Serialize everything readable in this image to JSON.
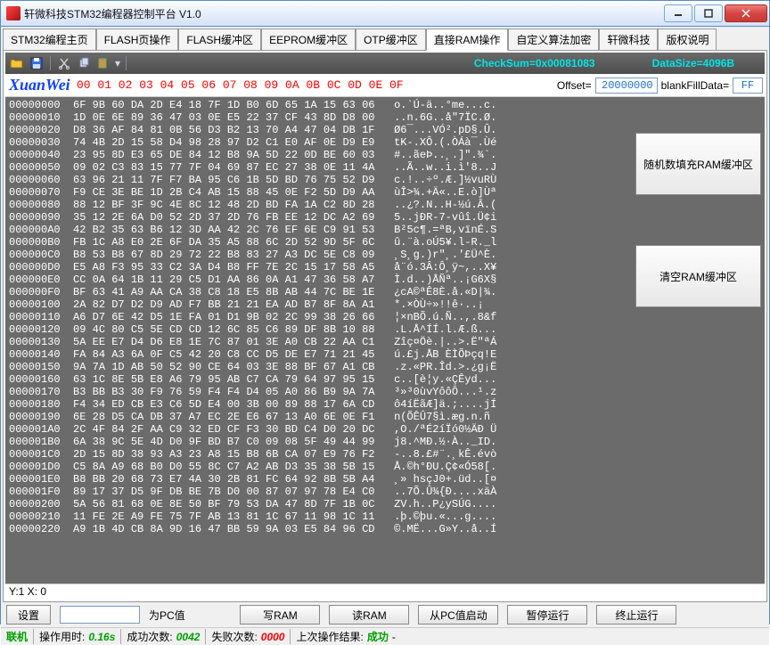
{
  "window": {
    "title": "轩微科技STM32编程器控制平台  V1.0"
  },
  "tabs": [
    "STM32编程主页",
    "FLASH页操作",
    "FLASH缓冲区",
    "EEPROM缓冲区",
    "OTP缓冲区",
    "直接RAM操作",
    "自定义算法加密",
    "轩微科技",
    "版权说明"
  ],
  "activeTab": 5,
  "toolbar": {
    "checksum": "CheckSum=0x00081083",
    "datasize": "DataSize=4096B"
  },
  "header": {
    "brand": "XuanWei",
    "cols": "00 01 02 03 04 05 06 07 08 09 0A 0B 0C 0D 0E 0F",
    "offsetLabel": "Offset=",
    "offset": "20000000",
    "blankLabel": "blankFillData=",
    "blank": "FF"
  },
  "statusYX": "Y:1   X: 0",
  "buttons": {
    "set": "设置",
    "pcLabel": "为PC值",
    "write": "写RAM",
    "read": "读RAM",
    "runpc": "从PC值启动",
    "pause": "暂停运行",
    "stop": "终止运行",
    "fill": "随机数填充RAM缓冲区",
    "clear": "清空RAM缓冲区"
  },
  "status": {
    "conn": "联机",
    "opTimeL": "操作用时:",
    "opTime": "0.16s",
    "okL": "成功次数:",
    "ok": "0042",
    "failL": "失败次数:",
    "fail": "0000",
    "lastL": "上次操作结果:",
    "last": "成功",
    "dash": "-"
  },
  "hex": [
    {
      "a": "00000000",
      "b": "6F 9B 60 DA 2D E4 18 7F 1D B0 6D 65 1A 15 63 06",
      "t": "o.`Ú-ä..°me...c."
    },
    {
      "a": "00000010",
      "b": "1D 0E 6E 89 36 47 03 0E E5 22 37 CF 43 8D D8 00",
      "t": "..n.6G..å\"7ÏC.Ø."
    },
    {
      "a": "00000020",
      "b": "D8 36 AF 84 81 0B 56 D3 B2 13 70 A4 47 04 DB 1F",
      "t": "Ø6¯...VÓ².pD§.Û."
    },
    {
      "a": "00000030",
      "b": "74 4B 2D 15 58 D4 98 28 97 D2 C1 E0 AF 0E D9 E9",
      "t": "tK-.XÔ.(.ÒÁà¯.Ùé"
    },
    {
      "a": "00000040",
      "b": "23 95 8D E3 65 DE 84 12 B8 9A 5D 22 0D BE 60 03",
      "t": "#..ãeÞ..¸.]\".¾`."
    },
    {
      "a": "00000050",
      "b": "09 02 C3 83 15 77 7F 04 69 87 EC 27 38 0E 11 4A",
      "t": "..Ã..w..i.ì'8..J"
    },
    {
      "a": "00000060",
      "b": "63 96 21 11 7F F7 BA 95 C6 1B 5D BD 76 75 52 D9",
      "t": "c.!..÷º.Æ.]½vuRÙ"
    },
    {
      "a": "00000070",
      "b": "F9 CE 3E BE 1D 2B C4 AB 15 88 45 0E F2 5D D9 AA",
      "t": "ùÎ>¾.+Ä«..E.ò]Ùª"
    },
    {
      "a": "00000080",
      "b": "88 12 BF 3F 9C 4E 8C 12 48 2D BD FA 1A C2 8D 28",
      "t": "..¿?.N..H-½ú.Â.("
    },
    {
      "a": "00000090",
      "b": "35 12 2E 6A D0 52 2D 37 2D 76 FB EE 12 DC A2 69",
      "t": "5..jÐR-7-vûî.Ü¢i"
    },
    {
      "a": "000000A0",
      "b": "42 B2 35 63 B6 12 3D AA 42 2C 76 EF 6E C9 91 53",
      "t": "B²5c¶.=ªB,vïnÉ.S"
    },
    {
      "a": "000000B0",
      "b": "FB 1C A8 E0 2E 6F DA 35 A5 88 6C 2D 52 9D 5F 6C",
      "t": "û.¨à.oÚ5¥.l-R._l"
    },
    {
      "a": "000000C0",
      "b": "B8 53 B8 67 8D 29 72 22 B8 83 27 A3 DC 5E C8 09",
      "t": "¸S¸g.)r\"¸.'£Ü^È."
    },
    {
      "a": "000000D0",
      "b": "E5 A8 F3 95 33 C2 3A D4 B8 FF 7E 2C 15 17 58 A5",
      "t": "å¨ó.3Â:Ô¸ÿ~,..X¥"
    },
    {
      "a": "000000E0",
      "b": "CC 0A 64 1B 11 29 C5 D1 AA 86 0A A1 47 36 58 A7",
      "t": "Ì.d..)ÅÑª..¡G6X§"
    },
    {
      "a": "000000F0",
      "b": "BF 63 41 A9 AA CA 38 C8 18 E5 8B AB 44 7C BE 1E",
      "t": "¿cA©ªÊ8È.å.«D|¾."
    },
    {
      "a": "00000100",
      "b": "2A 82 D7 D2 D9 AD F7 BB 21 21 EA AD B7 8F 8A A1",
      "t": "*.×ÒÙ­÷»!!ê­·..¡"
    },
    {
      "a": "00000110",
      "b": "A6 D7 6E 42 D5 1E FA 01 D1 9B 02 2C 99 38 26 66",
      "t": "¦×nBÕ.ú.Ñ..,.8&f"
    },
    {
      "a": "00000120",
      "b": "09 4C 80 C5 5E CD CD 12 6C 85 C6 89 DF 8B 10 88",
      "t": ".L.Å^ÍÍ.l.Æ.ß..."
    },
    {
      "a": "00000130",
      "b": "5A EE E7 D4 D6 E8 1E 7C 87 01 3E A0 CB 22 AA C1",
      "t": "Zîç¤Öè.|..>.Ë\"ªÁ"
    },
    {
      "a": "00000140",
      "b": "FA 84 A3 6A 0F C5 42 20 C8 CC D5 DE E7 71 21 45",
      "t": "ú.£j.ÅB ÈÌÕÞçq!E"
    },
    {
      "a": "00000150",
      "b": "9A 7A 1D AB 50 52 90 CE 64 03 3E 88 BF 67 A1 CB",
      "t": ".z.«PR.Îd.>.¿g¡Ë"
    },
    {
      "a": "00000160",
      "b": "63 1C 8E 5B E8 A6 79 95 AB C7 CA 79 64 97 95 15",
      "t": "c..[è¦y.«ÇÊyd..."
    },
    {
      "a": "00000170",
      "b": "B3 BB B3 30 F9 76 59 F4 F4 D4 05 A0 86 B9 9A 7A",
      "t": "³»³0ùvYôôÔ...¹.z"
    },
    {
      "a": "00000180",
      "b": "F4 34 ED CB E3 C6 5D E4 00 3B 00 89 88 17 6A CD",
      "t": "ô4íËãÆ]ä.;....jÍ"
    },
    {
      "a": "00000190",
      "b": "6E 28 D5 CA DB 37 A7 EC 2E E6 67 13 A0 6E 0E F1",
      "t": "n(ÕÊÛ7§ì.æg.n.ñ"
    },
    {
      "a": "000001A0",
      "b": "2C 4F 84 2F AA C9 32 ED CF F3 30 BD C4 D0 20 DC",
      "t": ",O./ªÉ2íÏó0½ÄÐ Ü"
    },
    {
      "a": "000001B0",
      "b": "6A 38 9C 5E 4D D0 9F BD B7 C0 09 08 5F 49 44 99",
      "t": "j8.^MÐ.½·À.._ID."
    },
    {
      "a": "000001C0",
      "b": "2D 15 8D 38 93 A3 23 A8 15 B8 6B CA 07 E9 76 F2",
      "t": "-..8.£#¨.¸kÊ.évò"
    },
    {
      "a": "000001D0",
      "b": "C5 8A A9 68 B0 D0 55 8C C7 A2 AB D3 35 38 5B 15",
      "t": "Å.©h°ÐU.Ç¢«Ó58[."
    },
    {
      "a": "000001E0",
      "b": "B8 BB 20 68 73 E7 4A 30 2B 81 FC 64 92 8B 5B A4",
      "t": "¸» hsçJ0+.üd..[¤"
    },
    {
      "a": "000001F0",
      "b": "89 17 37 D5 9F DB BE 7B D0 00 87 07 97 78 E4 C0",
      "t": "..7Õ.Û¾{Ð....xäÀ"
    },
    {
      "a": "00000200",
      "b": "5A 56 81 68 0E 8E 50 BF 79 53 DA 47 8D 7F 1B 0C",
      "t": "ZV.h..P¿ySÚG...."
    },
    {
      "a": "00000210",
      "b": "11 FE 2E A9 FE 75 7F AB 13 81 1C 67 11 98 1C 11",
      "t": ".þ.©þu.«...g...."
    },
    {
      "a": "00000220",
      "b": "A9 1B 4D CB 8A 9D 16 47 BB 59 9A 03 E5 84 96 CD",
      "t": "©.MË...G»Y..å..Í"
    }
  ]
}
